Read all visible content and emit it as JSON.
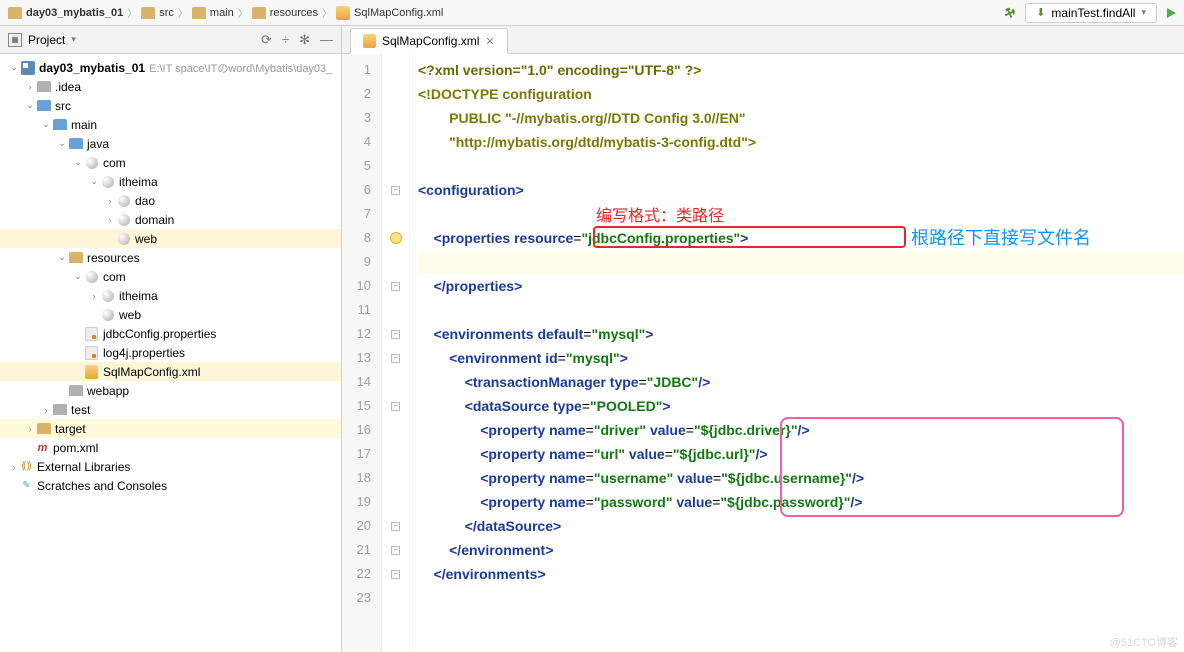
{
  "breadcrumbs": [
    "day03_mybatis_01",
    "src",
    "main",
    "resources",
    "SqlMapConfig.xml"
  ],
  "run_config": "mainTest.findAll",
  "project_panel_title": "Project",
  "tree": [
    {
      "d": 0,
      "arr": "v",
      "ic": "mod",
      "txt": "day03_mybatis_01",
      "suf": "E:\\IT space\\ITのword\\Mybatis\\day03_",
      "bold": true
    },
    {
      "d": 1,
      "arr": ">",
      "ic": "fld",
      "txt": ".idea"
    },
    {
      "d": 1,
      "arr": "v",
      "ic": "fld blue",
      "txt": "src"
    },
    {
      "d": 2,
      "arr": "v",
      "ic": "fld blue",
      "txt": "main"
    },
    {
      "d": 3,
      "arr": "v",
      "ic": "fld blue",
      "txt": "java"
    },
    {
      "d": 4,
      "arr": "v",
      "ic": "pkg",
      "txt": "com"
    },
    {
      "d": 5,
      "arr": "v",
      "ic": "pkg",
      "txt": "itheima"
    },
    {
      "d": 6,
      "arr": ">",
      "ic": "pkg",
      "txt": "dao"
    },
    {
      "d": 6,
      "arr": ">",
      "ic": "pkg",
      "txt": "domain"
    },
    {
      "d": 6,
      "arr": "",
      "ic": "pkg",
      "txt": "web",
      "sel": true
    },
    {
      "d": 3,
      "arr": "v",
      "ic": "fld tan",
      "txt": "resources"
    },
    {
      "d": 4,
      "arr": "v",
      "ic": "pkg",
      "txt": "com"
    },
    {
      "d": 5,
      "arr": ">",
      "ic": "pkg",
      "txt": "itheima"
    },
    {
      "d": 5,
      "arr": "",
      "ic": "pkg",
      "txt": "web"
    },
    {
      "d": 4,
      "arr": "",
      "ic": "prop",
      "txt": "jdbcConfig.properties"
    },
    {
      "d": 4,
      "arr": "",
      "ic": "prop",
      "txt": "log4j.properties"
    },
    {
      "d": 4,
      "arr": "",
      "ic": "xml",
      "txt": "SqlMapConfig.xml",
      "sel": true
    },
    {
      "d": 3,
      "arr": "",
      "ic": "fld",
      "txt": "webapp"
    },
    {
      "d": 2,
      "arr": ">",
      "ic": "fld",
      "txt": "test"
    },
    {
      "d": 1,
      "arr": ">",
      "ic": "fld tan",
      "txt": "target",
      "tgt": true
    },
    {
      "d": 1,
      "arr": "",
      "ic": "m",
      "txt": "pom.xml"
    },
    {
      "d": 0,
      "arr": ">",
      "ic": "lib",
      "txt": "External Libraries"
    },
    {
      "d": 0,
      "arr": "",
      "ic": "scratch",
      "txt": "Scratches and Consoles"
    }
  ],
  "tab_name": "SqlMapConfig.xml",
  "code_lines": [
    {
      "n": 1,
      "raw": "<?xml version=\"1.0\" encoding=\"UTF-8\" ?>",
      "f": ""
    },
    {
      "n": 2,
      "raw": "<!DOCTYPE configuration",
      "f": ""
    },
    {
      "n": 3,
      "raw": "        PUBLIC \"-//mybatis.org//DTD Config 3.0//EN\"",
      "f": ""
    },
    {
      "n": 4,
      "raw": "        \"http://mybatis.org/dtd/mybatis-3-config.dtd\">",
      "f": ""
    },
    {
      "n": 5,
      "raw": "",
      "f": ""
    },
    {
      "n": 6,
      "raw": "<configuration>",
      "f": "o"
    },
    {
      "n": 7,
      "raw": "",
      "f": ""
    },
    {
      "n": 8,
      "raw": "    <properties resource=\"jdbcConfig.properties\">",
      "f": "o",
      "bulb": true
    },
    {
      "n": 9,
      "raw": "",
      "f": "",
      "hl": true
    },
    {
      "n": 10,
      "raw": "    </properties>",
      "f": "c"
    },
    {
      "n": 11,
      "raw": "",
      "f": ""
    },
    {
      "n": 12,
      "raw": "    <environments default=\"mysql\">",
      "f": "o"
    },
    {
      "n": 13,
      "raw": "        <environment id=\"mysql\">",
      "f": "o"
    },
    {
      "n": 14,
      "raw": "            <transactionManager type=\"JDBC\"/>",
      "f": ""
    },
    {
      "n": 15,
      "raw": "            <dataSource type=\"POOLED\">",
      "f": "o"
    },
    {
      "n": 16,
      "raw": "                <property name=\"driver\" value=\"${jdbc.driver}\"/>",
      "f": ""
    },
    {
      "n": 17,
      "raw": "                <property name=\"url\" value=\"${jdbc.url}\"/>",
      "f": ""
    },
    {
      "n": 18,
      "raw": "                <property name=\"username\" value=\"${jdbc.username}\"/>",
      "f": ""
    },
    {
      "n": 19,
      "raw": "                <property name=\"password\" value=\"${jdbc.password}\"/>",
      "f": ""
    },
    {
      "n": 20,
      "raw": "            </dataSource>",
      "f": "c"
    },
    {
      "n": 21,
      "raw": "        </environment>",
      "f": "c"
    },
    {
      "n": 22,
      "raw": "    </environments>",
      "f": "c"
    },
    {
      "n": 23,
      "raw": "",
      "f": ""
    }
  ],
  "annotation_red": "编写格式：类路径",
  "annotation_blue": "根路径下直接写文件名",
  "watermark": "@51CTO博客"
}
